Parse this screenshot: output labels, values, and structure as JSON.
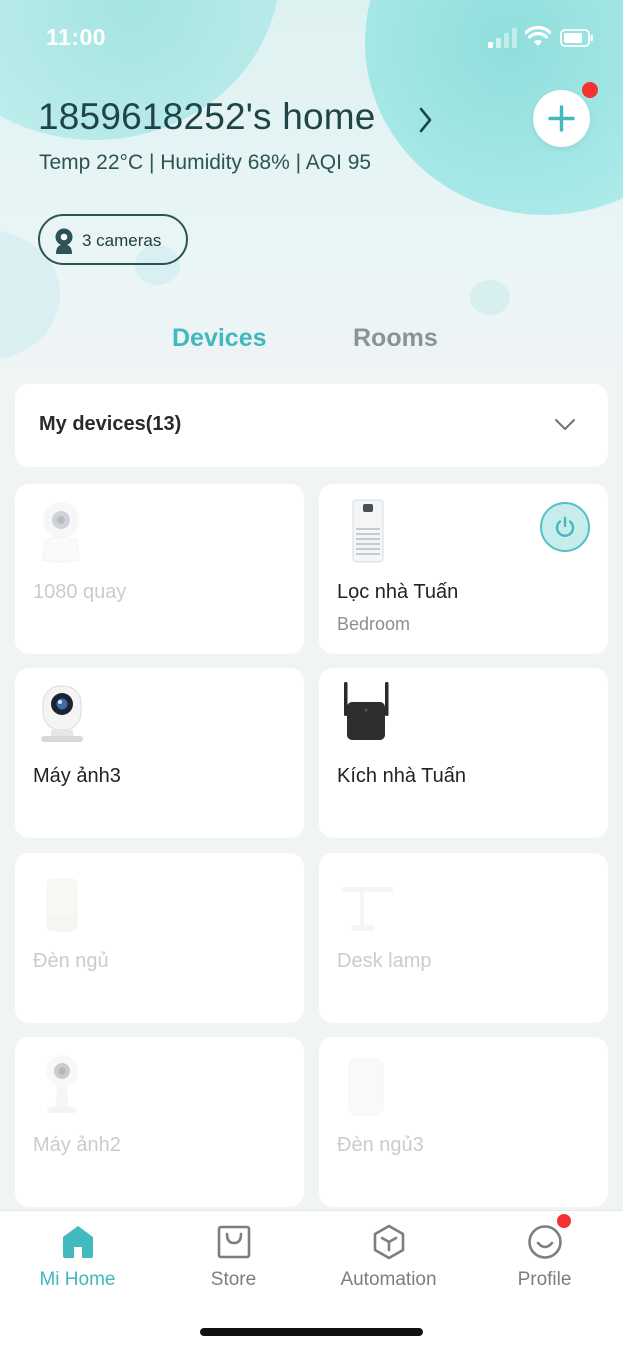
{
  "status_bar": {
    "time": "11:00"
  },
  "header": {
    "home_title": "1859618252's home",
    "env": "Temp 22°C | Humidity 68% | AQI 95",
    "cameras_label": "3 cameras"
  },
  "tabs": [
    {
      "label": "Devices",
      "active": true
    },
    {
      "label": "Rooms",
      "active": false
    }
  ],
  "my_devices": {
    "label": "My devices(13)"
  },
  "devices": [
    {
      "name": "1080 quay",
      "room": "",
      "icon": "camera-360-icon",
      "online": false
    },
    {
      "name": "Lọc nhà Tuấn",
      "room": "Bedroom",
      "icon": "air-purifier-icon",
      "online": true,
      "power": true
    },
    {
      "name": "Máy ảnh3",
      "room": "",
      "icon": "camera-icon",
      "online": true
    },
    {
      "name": "Kích nhà Tuấn",
      "room": "",
      "icon": "wifi-extender-icon",
      "online": true
    },
    {
      "name": "Đèn ngủ",
      "room": "",
      "icon": "bedside-lamp-icon",
      "online": false
    },
    {
      "name": "Desk lamp",
      "room": "",
      "icon": "desk-lamp-icon",
      "online": false
    },
    {
      "name": "Máy ảnh2",
      "room": "",
      "icon": "camera-icon",
      "online": false
    },
    {
      "name": "Đèn ngủ3",
      "room": "",
      "icon": "bedside-lamp-icon",
      "online": false
    }
  ],
  "nav": [
    {
      "label": "Mi Home",
      "icon": "home-icon",
      "active": true
    },
    {
      "label": "Store",
      "icon": "store-bag-icon",
      "active": false
    },
    {
      "label": "Automation",
      "icon": "automation-icon",
      "active": false
    },
    {
      "label": "Profile",
      "icon": "profile-icon",
      "active": false
    }
  ],
  "colors": {
    "accent": "#41b9bd",
    "badge": "#f43232",
    "title": "#1f4548"
  }
}
